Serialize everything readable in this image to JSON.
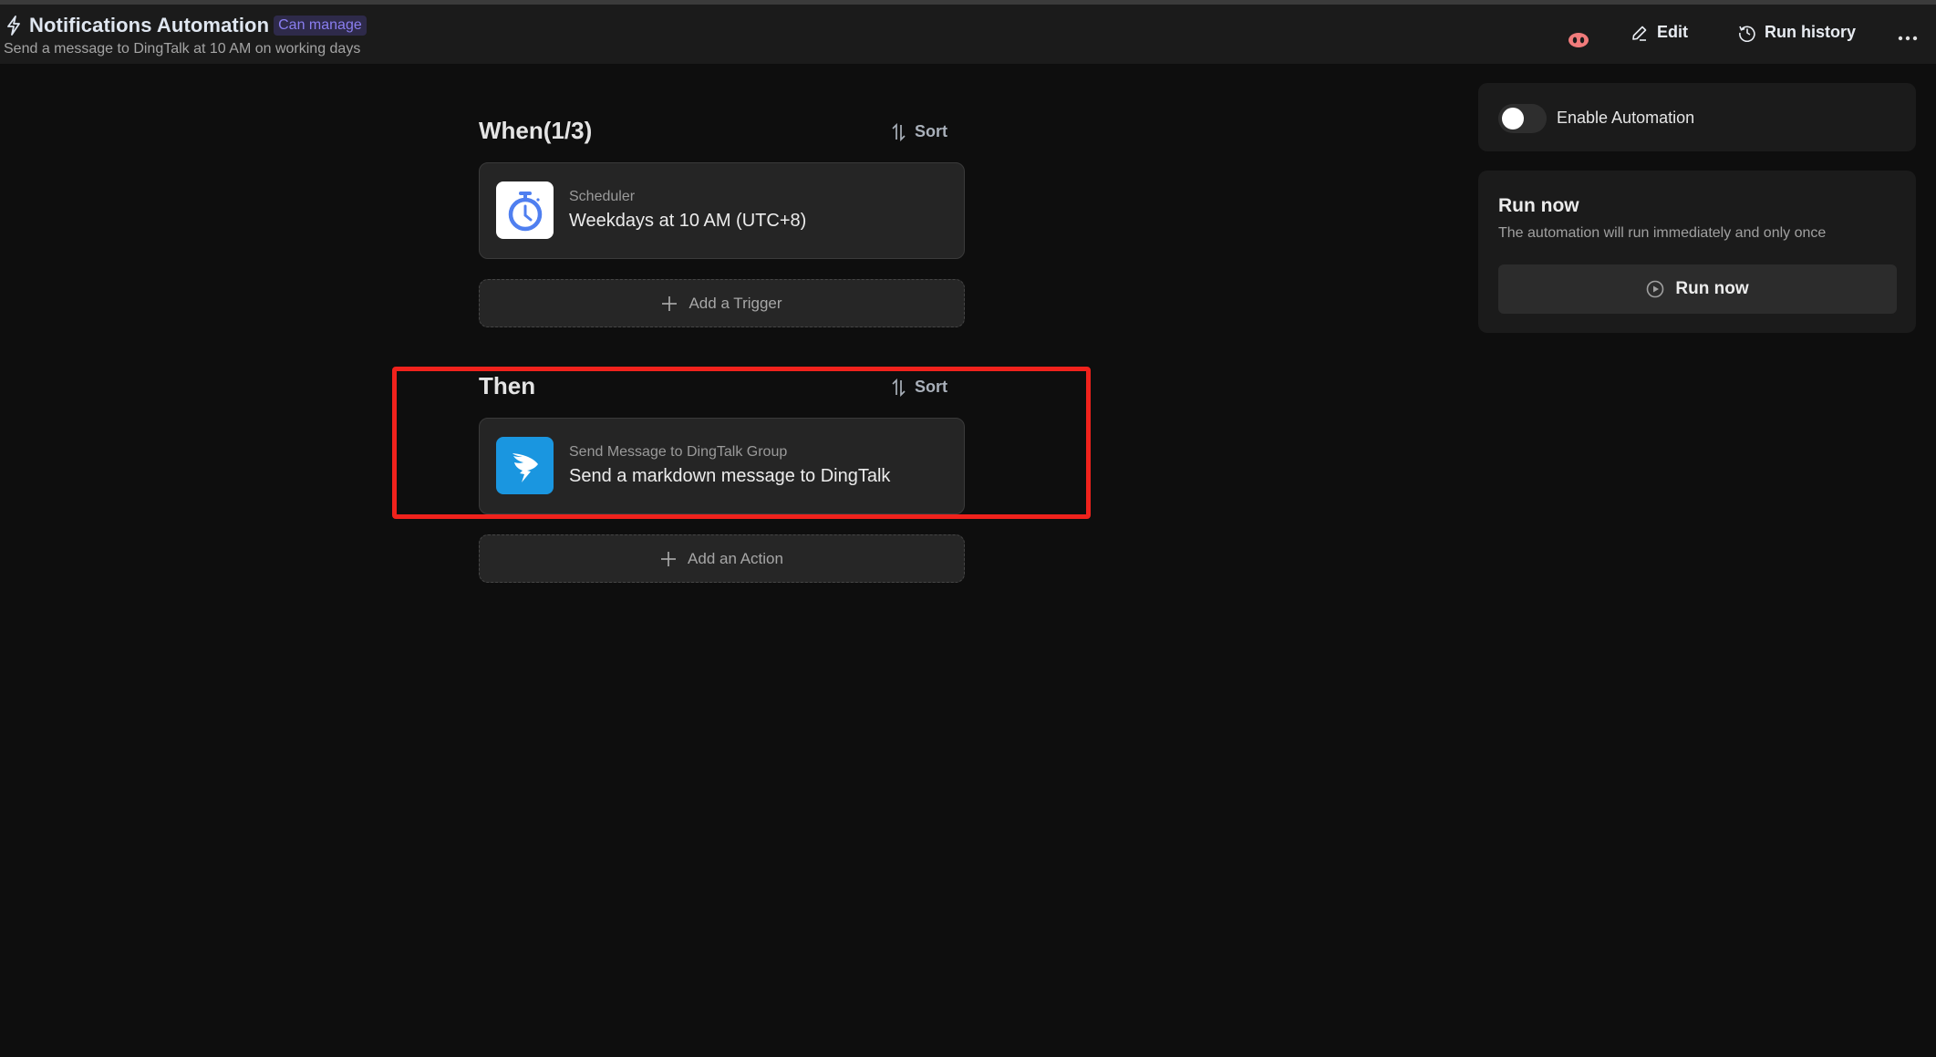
{
  "header": {
    "title": "Notifications Automation",
    "permission_badge": "Can manage",
    "subtitle": "Send a message to DingTalk at 10 AM on working days",
    "edit_label": "Edit",
    "run_history_label": "Run history",
    "icons": [
      "bolt-icon",
      "pig-avatar-icon",
      "pencil-icon",
      "history-icon",
      "more-icon"
    ]
  },
  "when": {
    "title": "When(1/3)",
    "sort_label": "Sort",
    "trigger": {
      "label": "Scheduler",
      "value": "Weekdays at 10 AM (UTC+8)",
      "icon": "stopwatch-icon"
    },
    "add_label": "Add a Trigger"
  },
  "then": {
    "title": "Then",
    "sort_label": "Sort",
    "action": {
      "label": "Send Message to DingTalk Group",
      "value": "Send a markdown message to DingTalk",
      "icon": "dingtalk-icon"
    },
    "add_label": "Add an Action"
  },
  "sidebar": {
    "enable_label": "Enable Automation",
    "enabled": false,
    "run_now_title": "Run now",
    "run_now_desc": "The automation will run immediately and only once",
    "run_now_button": "Run now"
  },
  "colors": {
    "badge_text": "#8a7ef0",
    "highlight": "#f0221c",
    "scheduler_icon": "#4f7ff0",
    "dingtalk_bg": "#1a96e0",
    "pig": "#f07b7b"
  }
}
